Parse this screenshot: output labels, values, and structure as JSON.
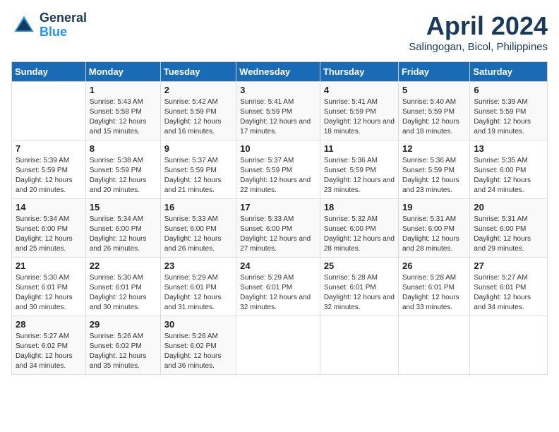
{
  "header": {
    "logo_line1": "General",
    "logo_line2": "Blue",
    "month": "April 2024",
    "location": "Salingogan, Bicol, Philippines"
  },
  "weekdays": [
    "Sunday",
    "Monday",
    "Tuesday",
    "Wednesday",
    "Thursday",
    "Friday",
    "Saturday"
  ],
  "weeks": [
    [
      {
        "num": "",
        "sunrise": "",
        "sunset": "",
        "daylight": ""
      },
      {
        "num": "1",
        "sunrise": "Sunrise: 5:43 AM",
        "sunset": "Sunset: 5:58 PM",
        "daylight": "Daylight: 12 hours and 15 minutes."
      },
      {
        "num": "2",
        "sunrise": "Sunrise: 5:42 AM",
        "sunset": "Sunset: 5:59 PM",
        "daylight": "Daylight: 12 hours and 16 minutes."
      },
      {
        "num": "3",
        "sunrise": "Sunrise: 5:41 AM",
        "sunset": "Sunset: 5:59 PM",
        "daylight": "Daylight: 12 hours and 17 minutes."
      },
      {
        "num": "4",
        "sunrise": "Sunrise: 5:41 AM",
        "sunset": "Sunset: 5:59 PM",
        "daylight": "Daylight: 12 hours and 18 minutes."
      },
      {
        "num": "5",
        "sunrise": "Sunrise: 5:40 AM",
        "sunset": "Sunset: 5:59 PM",
        "daylight": "Daylight: 12 hours and 18 minutes."
      },
      {
        "num": "6",
        "sunrise": "Sunrise: 5:39 AM",
        "sunset": "Sunset: 5:59 PM",
        "daylight": "Daylight: 12 hours and 19 minutes."
      }
    ],
    [
      {
        "num": "7",
        "sunrise": "Sunrise: 5:39 AM",
        "sunset": "Sunset: 5:59 PM",
        "daylight": "Daylight: 12 hours and 20 minutes."
      },
      {
        "num": "8",
        "sunrise": "Sunrise: 5:38 AM",
        "sunset": "Sunset: 5:59 PM",
        "daylight": "Daylight: 12 hours and 20 minutes."
      },
      {
        "num": "9",
        "sunrise": "Sunrise: 5:37 AM",
        "sunset": "Sunset: 5:59 PM",
        "daylight": "Daylight: 12 hours and 21 minutes."
      },
      {
        "num": "10",
        "sunrise": "Sunrise: 5:37 AM",
        "sunset": "Sunset: 5:59 PM",
        "daylight": "Daylight: 12 hours and 22 minutes."
      },
      {
        "num": "11",
        "sunrise": "Sunrise: 5:36 AM",
        "sunset": "Sunset: 5:59 PM",
        "daylight": "Daylight: 12 hours and 23 minutes."
      },
      {
        "num": "12",
        "sunrise": "Sunrise: 5:36 AM",
        "sunset": "Sunset: 5:59 PM",
        "daylight": "Daylight: 12 hours and 23 minutes."
      },
      {
        "num": "13",
        "sunrise": "Sunrise: 5:35 AM",
        "sunset": "Sunset: 6:00 PM",
        "daylight": "Daylight: 12 hours and 24 minutes."
      }
    ],
    [
      {
        "num": "14",
        "sunrise": "Sunrise: 5:34 AM",
        "sunset": "Sunset: 6:00 PM",
        "daylight": "Daylight: 12 hours and 25 minutes."
      },
      {
        "num": "15",
        "sunrise": "Sunrise: 5:34 AM",
        "sunset": "Sunset: 6:00 PM",
        "daylight": "Daylight: 12 hours and 26 minutes."
      },
      {
        "num": "16",
        "sunrise": "Sunrise: 5:33 AM",
        "sunset": "Sunset: 6:00 PM",
        "daylight": "Daylight: 12 hours and 26 minutes."
      },
      {
        "num": "17",
        "sunrise": "Sunrise: 5:33 AM",
        "sunset": "Sunset: 6:00 PM",
        "daylight": "Daylight: 12 hours and 27 minutes."
      },
      {
        "num": "18",
        "sunrise": "Sunrise: 5:32 AM",
        "sunset": "Sunset: 6:00 PM",
        "daylight": "Daylight: 12 hours and 28 minutes."
      },
      {
        "num": "19",
        "sunrise": "Sunrise: 5:31 AM",
        "sunset": "Sunset: 6:00 PM",
        "daylight": "Daylight: 12 hours and 28 minutes."
      },
      {
        "num": "20",
        "sunrise": "Sunrise: 5:31 AM",
        "sunset": "Sunset: 6:00 PM",
        "daylight": "Daylight: 12 hours and 29 minutes."
      }
    ],
    [
      {
        "num": "21",
        "sunrise": "Sunrise: 5:30 AM",
        "sunset": "Sunset: 6:01 PM",
        "daylight": "Daylight: 12 hours and 30 minutes."
      },
      {
        "num": "22",
        "sunrise": "Sunrise: 5:30 AM",
        "sunset": "Sunset: 6:01 PM",
        "daylight": "Daylight: 12 hours and 30 minutes."
      },
      {
        "num": "23",
        "sunrise": "Sunrise: 5:29 AM",
        "sunset": "Sunset: 6:01 PM",
        "daylight": "Daylight: 12 hours and 31 minutes."
      },
      {
        "num": "24",
        "sunrise": "Sunrise: 5:29 AM",
        "sunset": "Sunset: 6:01 PM",
        "daylight": "Daylight: 12 hours and 32 minutes."
      },
      {
        "num": "25",
        "sunrise": "Sunrise: 5:28 AM",
        "sunset": "Sunset: 6:01 PM",
        "daylight": "Daylight: 12 hours and 32 minutes."
      },
      {
        "num": "26",
        "sunrise": "Sunrise: 5:28 AM",
        "sunset": "Sunset: 6:01 PM",
        "daylight": "Daylight: 12 hours and 33 minutes."
      },
      {
        "num": "27",
        "sunrise": "Sunrise: 5:27 AM",
        "sunset": "Sunset: 6:01 PM",
        "daylight": "Daylight: 12 hours and 34 minutes."
      }
    ],
    [
      {
        "num": "28",
        "sunrise": "Sunrise: 5:27 AM",
        "sunset": "Sunset: 6:02 PM",
        "daylight": "Daylight: 12 hours and 34 minutes."
      },
      {
        "num": "29",
        "sunrise": "Sunrise: 5:26 AM",
        "sunset": "Sunset: 6:02 PM",
        "daylight": "Daylight: 12 hours and 35 minutes."
      },
      {
        "num": "30",
        "sunrise": "Sunrise: 5:26 AM",
        "sunset": "Sunset: 6:02 PM",
        "daylight": "Daylight: 12 hours and 36 minutes."
      },
      {
        "num": "",
        "sunrise": "",
        "sunset": "",
        "daylight": ""
      },
      {
        "num": "",
        "sunrise": "",
        "sunset": "",
        "daylight": ""
      },
      {
        "num": "",
        "sunrise": "",
        "sunset": "",
        "daylight": ""
      },
      {
        "num": "",
        "sunrise": "",
        "sunset": "",
        "daylight": ""
      }
    ]
  ]
}
